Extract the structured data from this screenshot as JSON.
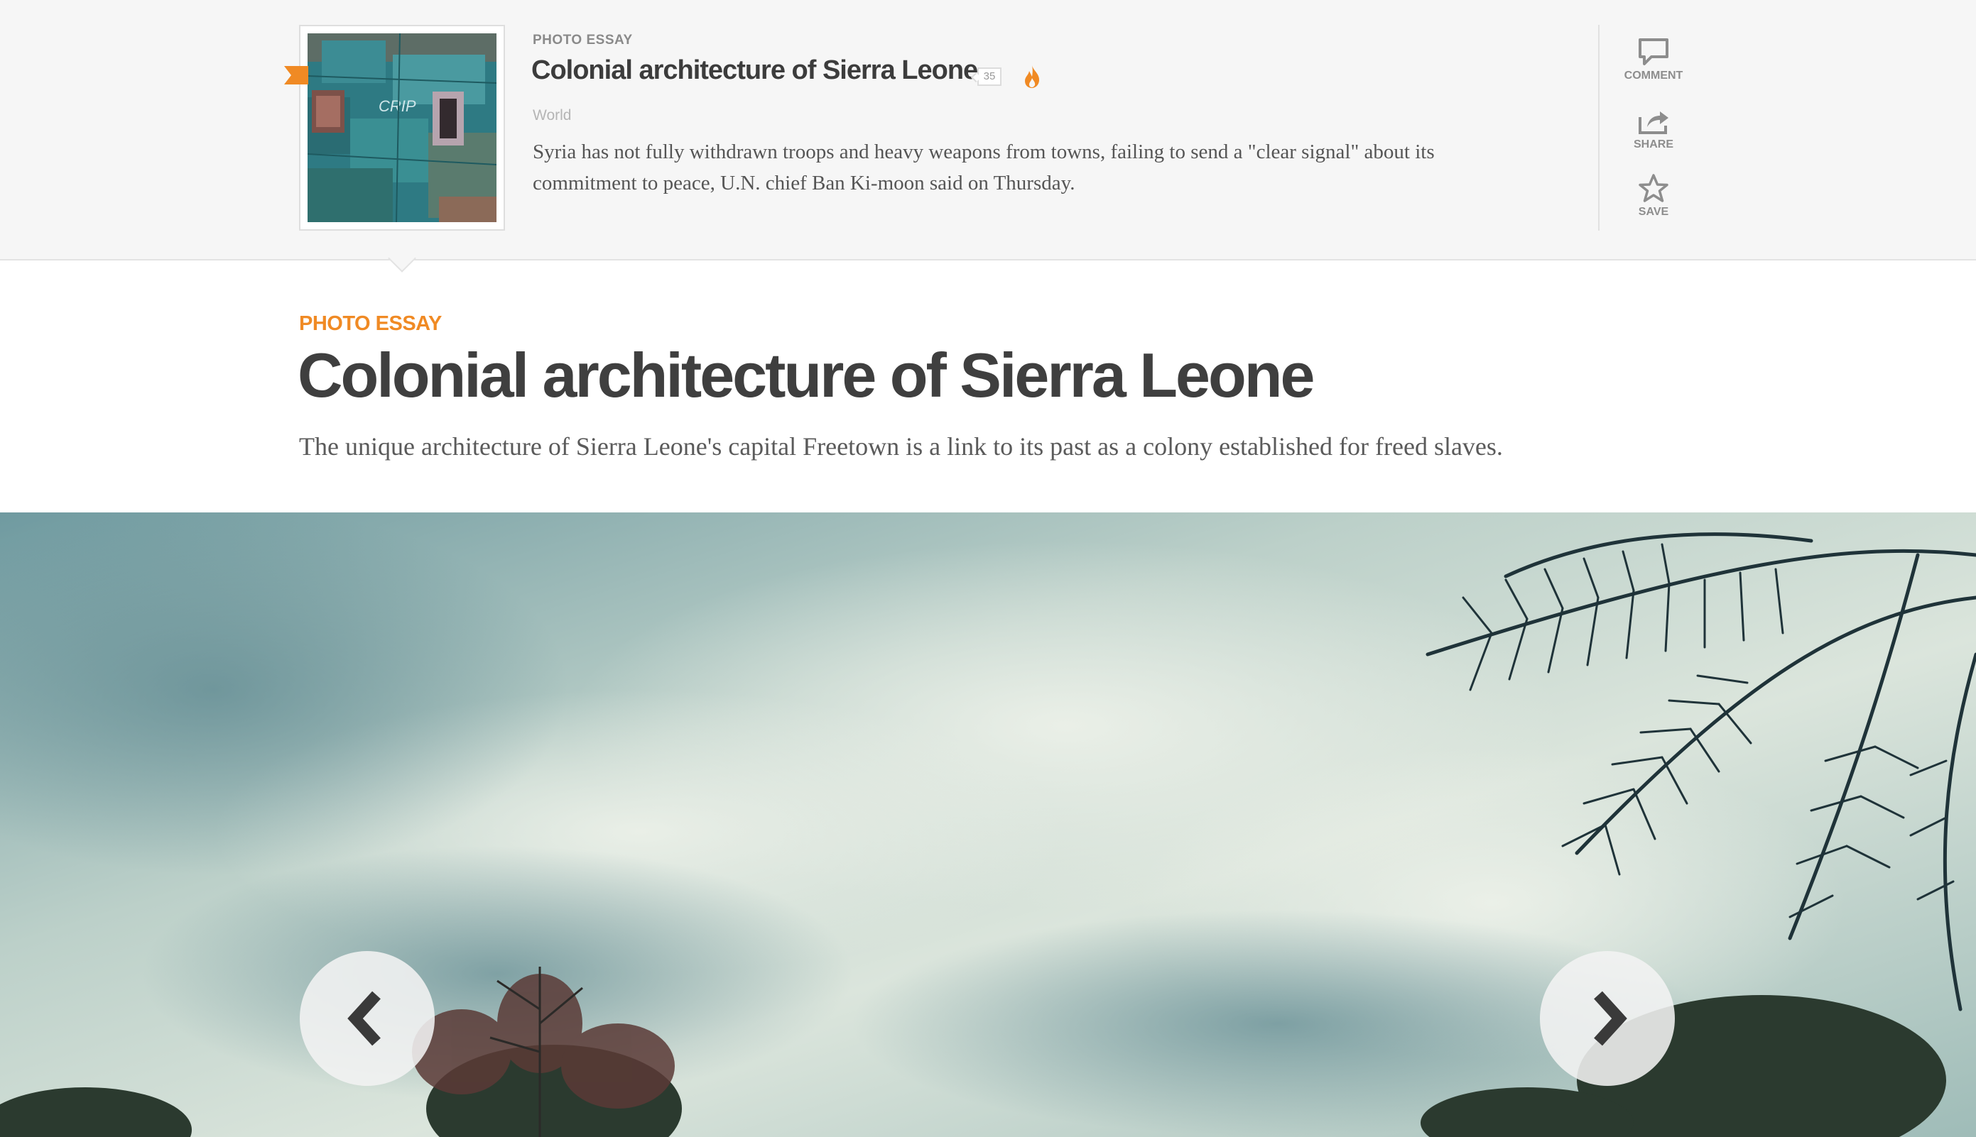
{
  "top_card": {
    "kicker": "PHOTO ESSAY",
    "title": "Colonial architecture of Sierra Leone",
    "comment_count": "35",
    "section": "World",
    "summary": "Syria has not fully withdrawn troops and heavy weapons from towns, failing to send a \"clear signal\" about its commitment to peace, U.N. chief Ban Ki-moon said on Thursday.",
    "actions": {
      "comment": "COMMENT",
      "share": "SHARE",
      "save": "SAVE"
    }
  },
  "article": {
    "kicker": "PHOTO ESSAY",
    "headline": "Colonial architecture of Sierra Leone",
    "dek": "The unique architecture of Sierra Leone's capital Freetown is a link to its past as a colony established for freed slaves."
  },
  "colors": {
    "accent": "#f08a24",
    "headline": "#3f3f3f",
    "strip_bg": "#f6f6f6"
  },
  "icons": [
    "flag-ribbon-icon",
    "flame-icon",
    "comment-icon",
    "share-icon",
    "star-icon",
    "chevron-left-icon",
    "chevron-right-icon"
  ]
}
